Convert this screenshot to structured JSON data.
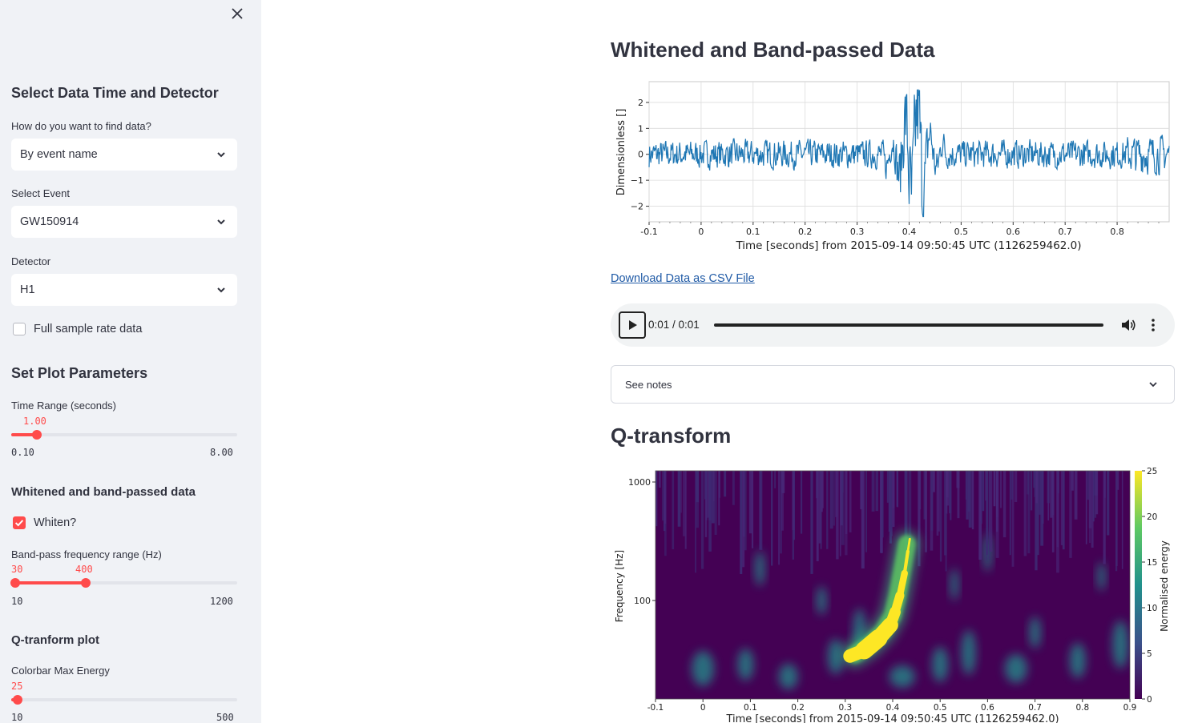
{
  "sidebar": {
    "section1_title": "Select Data Time and Detector",
    "find_label": "How do you want to find data?",
    "find_value": "By event name",
    "event_label": "Select Event",
    "event_value": "GW150914",
    "detector_label": "Detector",
    "detector_value": "H1",
    "fullrate_label": "Full sample rate data",
    "fullrate_checked": false,
    "section2_title": "Set Plot Parameters",
    "time_range": {
      "label": "Time Range (seconds)",
      "value": "1.00",
      "min": "0.10",
      "max": "8.00",
      "fraction": 0.114
    },
    "whiten_title": "Whitened and band-passed data",
    "whiten_label": "Whiten?",
    "whiten_checked": true,
    "band": {
      "label": "Band-pass frequency range (Hz)",
      "low": "30",
      "high": "400",
      "min": "10",
      "max": "1200",
      "low_fraction": 0.017,
      "high_fraction": 0.328
    },
    "q_title": "Q-tranform plot",
    "colorbar": {
      "label": "Colorbar Max Energy",
      "value": "25",
      "min": "10",
      "max": "500",
      "fraction": 0.031
    }
  },
  "main": {
    "title1": "Whitened and Band-passed Data",
    "download_link": "Download Data as CSV File",
    "audio_time": "0:01 / 0:01",
    "notes_label": "See notes",
    "title2": "Q-transform"
  },
  "icons": {
    "close": "close-icon",
    "chevron": "chevron-down-icon",
    "play": "play-icon",
    "volume": "volume-icon",
    "more": "more-vert-icon"
  },
  "colors": {
    "accent": "#ff4b4b",
    "sidebar_bg": "#f0f2f6",
    "trace": "#1f77b4",
    "link": "#1f5aa6"
  },
  "chart_data": [
    {
      "type": "line",
      "title": "",
      "xlabel": "Time [seconds] from 2015-09-14 09:50:45 UTC (1126259462.0)",
      "ylabel": "Dimensionless []",
      "xlim": [
        -0.1,
        0.9
      ],
      "ylim": [
        -2.6,
        2.8
      ],
      "xticks": [
        "-0.1",
        "0",
        "0.1",
        "0.2",
        "0.3",
        "0.4",
        "0.5",
        "0.6",
        "0.7",
        "0.8"
      ],
      "yticks": [
        "2",
        "1",
        "0",
        "−1",
        "−2"
      ],
      "grid": true,
      "series": [
        {
          "values_note": "",
          "peak_time": 0.41,
          "peaks": [
            [
              0.35,
              1.5
            ],
            [
              0.39,
              1.9
            ],
            [
              0.4,
              2.4
            ],
            [
              0.41,
              2.5
            ],
            [
              0.42,
              -2.4
            ],
            [
              0.38,
              -1.6
            ],
            [
              0.36,
              -1.2
            ]
          ]
        }
      ]
    },
    {
      "type": "heatmap",
      "title": "",
      "xlabel": "Time [seconds] from 2015-09-14 09:50:45 UTC (1126259462.0)",
      "ylabel": "Frequency [Hz]",
      "xlim": [
        -0.1,
        0.9
      ],
      "xticks": [
        "-0.1",
        "0",
        "0.1",
        "0.2",
        "0.3",
        "0.4",
        "0.5",
        "0.6",
        "0.7",
        "0.8",
        "0.9"
      ],
      "yticks": [
        "1000",
        "100"
      ],
      "yscale": "log",
      "colorbar_label": "Normalised energy",
      "colorbar_ticks": [
        "25",
        "20",
        "15",
        "10",
        "5",
        "0"
      ],
      "colorbar_range": [
        0,
        25
      ],
      "colormap": "viridis",
      "chirp": [
        [
          0.32,
          35
        ],
        [
          0.35,
          42
        ],
        [
          0.38,
          55
        ],
        [
          0.4,
          75
        ],
        [
          0.41,
          110
        ],
        [
          0.42,
          180
        ],
        [
          0.43,
          300
        ]
      ]
    }
  ]
}
